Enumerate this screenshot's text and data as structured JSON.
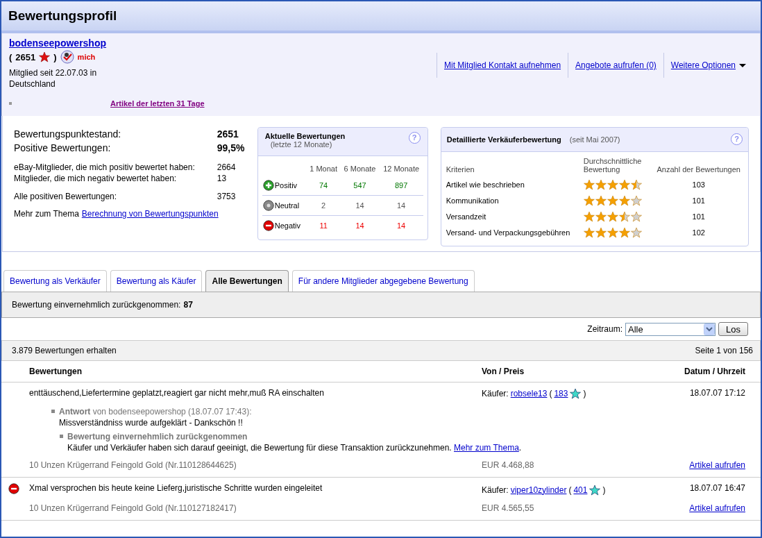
{
  "page_title": "Bewertungsprofil",
  "member": {
    "name": "bodenseepowershop",
    "paren_open": "(",
    "score": "2651",
    "paren_close": ")",
    "me_badge": "mich",
    "since": "Mitglied seit 22.07.03 in Deutschland",
    "recent_link": "Artikel der letzten 31 Tage"
  },
  "actions": [
    {
      "label": "Mit Mitglied Kontakt aufnehmen",
      "dropdown": false
    },
    {
      "label": "Angebote aufrufen (0)",
      "dropdown": false
    },
    {
      "label": "Weitere Optionen",
      "dropdown": true
    }
  ],
  "summary": {
    "rows": [
      {
        "label": "Bewertungspunktestand:",
        "value": "2651",
        "kind": "big"
      },
      {
        "label": "Positive Bewertungen:",
        "value": "99,5%",
        "kind": "big"
      },
      {
        "label": "eBay-Mitglieder, die mich positiv bewertet haben:",
        "value": "2664",
        "kind": "small"
      },
      {
        "label": "Mitglieder, die mich negativ bewertet haben:",
        "value": "13",
        "kind": "small"
      },
      {
        "label": "Alle positiven Bewertungen:",
        "value": "3753",
        "kind": "small"
      }
    ],
    "more_text": "Mehr zum Thema",
    "more_link": "Berechnung von Bewertungspunkten"
  },
  "recent": {
    "title": "Aktuelle Bewertungen",
    "subtitle": "(letzte 12 Monate)",
    "help": "?",
    "columns": [
      "1 Monat",
      "6 Monate",
      "12 Monate"
    ],
    "rows": [
      {
        "kind": "positive",
        "label": "Positiv",
        "values": [
          "74",
          "547",
          "897"
        ]
      },
      {
        "kind": "neutral",
        "label": "Neutral",
        "values": [
          "2",
          "14",
          "14"
        ]
      },
      {
        "kind": "negative",
        "label": "Negativ",
        "values": [
          "11",
          "14",
          "14"
        ]
      }
    ]
  },
  "detailed": {
    "title": "Detaillierte Verkäuferbewertung",
    "subtitle": "(seit Mai 2007)",
    "help": "?",
    "columns": [
      "Kriterien",
      "Durchschnittliche Bewertung",
      "Anzahl der Bewertungen"
    ],
    "rows": [
      {
        "label": "Artikel wie beschrieben",
        "stars": 4.5,
        "count": "103"
      },
      {
        "label": "Kommunikation",
        "stars": 4,
        "count": "101"
      },
      {
        "label": "Versandzeit",
        "stars": 3.5,
        "count": "101"
      },
      {
        "label": "Versand- und Verpackungsgebühren",
        "stars": 4,
        "count": "102"
      }
    ]
  },
  "tabs": [
    {
      "label": "Bewertung als Verkäufer",
      "selected": false
    },
    {
      "label": "Bewertung als Käufer",
      "selected": false
    },
    {
      "label": "Alle Bewertungen",
      "selected": true
    },
    {
      "label": "Für andere Mitglieder abgegebene Bewertung",
      "selected": false
    }
  ],
  "withdrawn_bar": {
    "label": "Bewertung einvernehmlich zurückgenommen:",
    "count": "87"
  },
  "filter": {
    "label": "Zeitraum:",
    "value": "Alle",
    "button": "Los"
  },
  "list": {
    "total": "3.879 Bewertungen erhalten",
    "page": "Seite 1 von 156",
    "columns": [
      "Bewertungen",
      "Von / Preis",
      "Datum / Uhrzeit"
    ],
    "entries": [
      {
        "kind": "withdrawn",
        "comment": "enttäuschend,Liefertermine geplatzt,reagiert gar nicht mehr,muß RA einschalten",
        "role": "Käufer:",
        "user": "robsele13",
        "paren_open": "(",
        "user_score": "183",
        "paren_close": ")",
        "date": "18.07.07 17:12",
        "reply": {
          "label": "Antwort",
          "by": "von bodenseepowershop (18.07.07 17:43):",
          "text": "Missverständniss wurde aufgeklärt - Dankschön !!"
        },
        "withdrawal": {
          "title": "Bewertung einvernehmlich zurückgenommen",
          "text": "Käufer und Verkäufer haben sich darauf geeinigt, die Bewertung für diese Transaktion zurückzunehmen.",
          "link": "Mehr zum Thema",
          "end": "."
        },
        "item": "10 Unzen Krügerrand Feingold Gold (Nr.110128644625)",
        "price": "EUR 4.468,88",
        "link": "Artikel aufrufen"
      },
      {
        "kind": "negative",
        "comment": "Xmal versprochen bis heute keine Lieferg,juristische Schritte wurden eingeleitet",
        "role": "Käufer:",
        "user": "viper10zylinder",
        "paren_open": "(",
        "user_score": "401",
        "paren_close": ")",
        "date": "18.07.07 16:47",
        "item": "10 Unzen Krügerrand Feingold Gold (Nr.110127182417)",
        "price": "EUR 4.565,55",
        "link": "Artikel aufrufen"
      }
    ]
  }
}
